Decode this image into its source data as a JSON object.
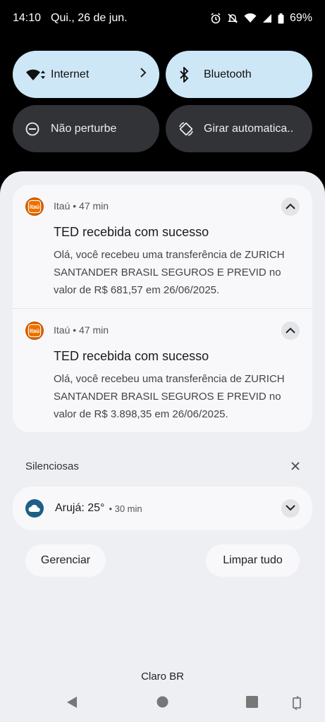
{
  "status_bar": {
    "time": "14:10",
    "date": "Qui., 26 de jun.",
    "battery": "69%"
  },
  "quick_tiles": [
    {
      "label": "Internet",
      "icon": "wifi-icon",
      "state": "on"
    },
    {
      "label": "Bluetooth",
      "icon": "bluetooth-icon",
      "state": "on"
    },
    {
      "label": "Não perturbe",
      "icon": "dnd-icon",
      "state": "off"
    },
    {
      "label": "Girar automatica..",
      "icon": "rotate-icon",
      "state": "off"
    }
  ],
  "notifications": [
    {
      "app": "Itaú",
      "time": "47 min",
      "meta": "Itaú • 47 min",
      "title": "TED recebida com sucesso",
      "body": "Olá, você recebeu uma transferência de ZURICH SANTANDER BRASIL SEGUROS E PREVID no valor de R$ 681,57 em 26/06/2025."
    },
    {
      "app": "Itaú",
      "time": "47 min",
      "meta": "Itaú • 47 min",
      "title": "TED recebida com sucesso",
      "body": "Olá, você recebeu uma transferência de ZURICH SANTANDER BRASIL SEGUROS E PREVID no valor de R$ 3.898,35 em 26/06/2025."
    }
  ],
  "app_icon_text": "itaú",
  "silent": {
    "header": "Silenciosas",
    "weather_title": "Arujá: 25°",
    "weather_time": "• 30 min"
  },
  "actions": {
    "manage": "Gerenciar",
    "clear_all": "Limpar tudo"
  },
  "carrier": "Claro BR",
  "colors": {
    "tile_on": "#cde7f7",
    "tile_off": "#323336",
    "itau_orange": "#ec7000",
    "weather_blue": "#1e5f86"
  }
}
